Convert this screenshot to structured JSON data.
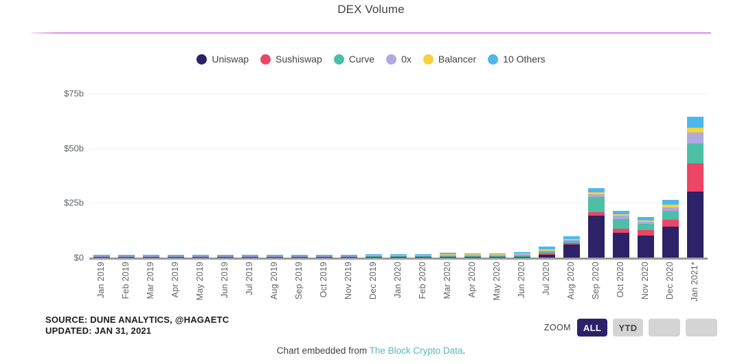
{
  "title": "DEX Volume",
  "colors": {
    "uniswap": "#2d2168",
    "sushiswap": "#ec4565",
    "curve": "#4cbfa6",
    "zrx": "#b0a8e0",
    "balancer": "#f5d23e",
    "others": "#4cb8ea",
    "rule": "#d98ce8",
    "link": "#55b8c0",
    "baseline": "#9a9a9a",
    "grid": "#f0f0f0",
    "active_button": "#2d2168",
    "inactive_button": "#d4d4d4"
  },
  "legend": [
    {
      "label": "Uniswap",
      "key": "uniswap",
      "color": "#2d2168"
    },
    {
      "label": "Sushiswap",
      "key": "sushiswap",
      "color": "#ec4565"
    },
    {
      "label": "Curve",
      "key": "curve",
      "color": "#4cbfa6"
    },
    {
      "label": "0x",
      "key": "zrx",
      "color": "#b0a8e0"
    },
    {
      "label": "Balancer",
      "key": "balancer",
      "color": "#f5d23e"
    },
    {
      "label": "10 Others",
      "key": "others",
      "color": "#4cb8ea"
    }
  ],
  "footer": {
    "source": "SOURCE: DUNE ANALYTICS, @HAGAETC",
    "updated": "UPDATED: JAN 31, 2021",
    "zoom_label": "ZOOM",
    "zoom_buttons": [
      {
        "label": "ALL",
        "active": true
      },
      {
        "label": "YTD",
        "active": false
      },
      {
        "label": "",
        "active": false
      },
      {
        "label": "",
        "active": false
      }
    ],
    "embed_prefix": "Chart embedded from ",
    "embed_link": "The Block Crypto Data",
    "embed_suffix": "."
  },
  "chart_data": {
    "type": "bar",
    "stacked": true,
    "title": "DEX Volume",
    "xlabel": "",
    "ylabel": "",
    "ylim": [
      0,
      80
    ],
    "yticks": [
      0,
      25,
      50,
      75
    ],
    "ytick_labels": [
      "$0",
      "$25b",
      "$50b",
      "$75b"
    ],
    "unit": "billions of USD",
    "grid": true,
    "legend_position": "top-center",
    "annotations": [
      "Jan 2021 marked with an asterisk (partial/estimated month)"
    ],
    "categories": [
      "Jan 2019",
      "Feb 2019",
      "Mar 2019",
      "Apr 2019",
      "May 2019",
      "Jun 2019",
      "Jul 2019",
      "Aug 2019",
      "Sep 2019",
      "Oct 2019",
      "Nov 2019",
      "Dec 2019",
      "Jan 2020",
      "Feb 2020",
      "Mar 2020",
      "Apr 2020",
      "May 2020",
      "Jun 2020",
      "Jul 2020",
      "Aug 2020",
      "Sep 2020",
      "Oct 2020",
      "Nov 2020",
      "Dec 2020",
      "Jan 2021*"
    ],
    "series": [
      {
        "name": "Uniswap",
        "color": "#2d2168",
        "values": [
          0.02,
          0.02,
          0.03,
          0.03,
          0.04,
          0.05,
          0.05,
          0.04,
          0.04,
          0.05,
          0.05,
          0.06,
          0.12,
          0.18,
          0.22,
          0.15,
          0.22,
          0.45,
          1.4,
          5.9,
          19.1,
          11.4,
          10.2,
          14.0,
          30.0
        ]
      },
      {
        "name": "Sushiswap",
        "color": "#ec4565",
        "values": [
          0,
          0,
          0,
          0,
          0,
          0,
          0,
          0,
          0,
          0,
          0,
          0,
          0,
          0,
          0,
          0,
          0,
          0,
          0.05,
          0.55,
          1.7,
          1.9,
          2.3,
          3.2,
          13.0
        ]
      },
      {
        "name": "Curve",
        "color": "#4cbfa6",
        "values": [
          0,
          0,
          0,
          0,
          0,
          0,
          0,
          0,
          0,
          0,
          0,
          0.01,
          0.02,
          0.05,
          0.12,
          0.1,
          0.3,
          0.6,
          1.0,
          1.1,
          6.8,
          4.4,
          2.8,
          4.2,
          9.0
        ]
      },
      {
        "name": "0x",
        "color": "#b0a8e0",
        "values": [
          0.03,
          0.03,
          0.04,
          0.03,
          0.04,
          0.04,
          0.04,
          0.03,
          0.03,
          0.03,
          0.03,
          0.04,
          0.08,
          0.12,
          0.15,
          0.08,
          0.12,
          0.18,
          0.35,
          0.5,
          1.2,
          1.3,
          1.0,
          1.6,
          5.0
        ]
      },
      {
        "name": "Balancer",
        "color": "#f5d23e",
        "values": [
          0,
          0,
          0,
          0,
          0,
          0,
          0,
          0,
          0,
          0,
          0,
          0,
          0,
          0,
          0.02,
          0.03,
          0.1,
          0.35,
          0.55,
          0.45,
          0.9,
          0.9,
          0.7,
          1.1,
          2.2
        ]
      },
      {
        "name": "10 Others",
        "color": "#4cb8ea",
        "values": [
          0.1,
          0.1,
          0.12,
          0.1,
          0.14,
          0.14,
          0.12,
          0.1,
          0.1,
          0.12,
          0.12,
          0.14,
          0.35,
          0.6,
          0.75,
          0.35,
          0.55,
          0.85,
          1.3,
          1.2,
          2.0,
          1.6,
          1.4,
          2.2,
          5.2
        ]
      }
    ],
    "totals": [
      0.15,
      0.15,
      0.19,
      0.16,
      0.22,
      0.23,
      0.21,
      0.17,
      0.17,
      0.2,
      0.2,
      0.25,
      0.57,
      0.95,
      1.26,
      0.71,
      1.29,
      2.43,
      4.65,
      9.7,
      31.7,
      21.5,
      18.4,
      26.3,
      64.4
    ]
  }
}
